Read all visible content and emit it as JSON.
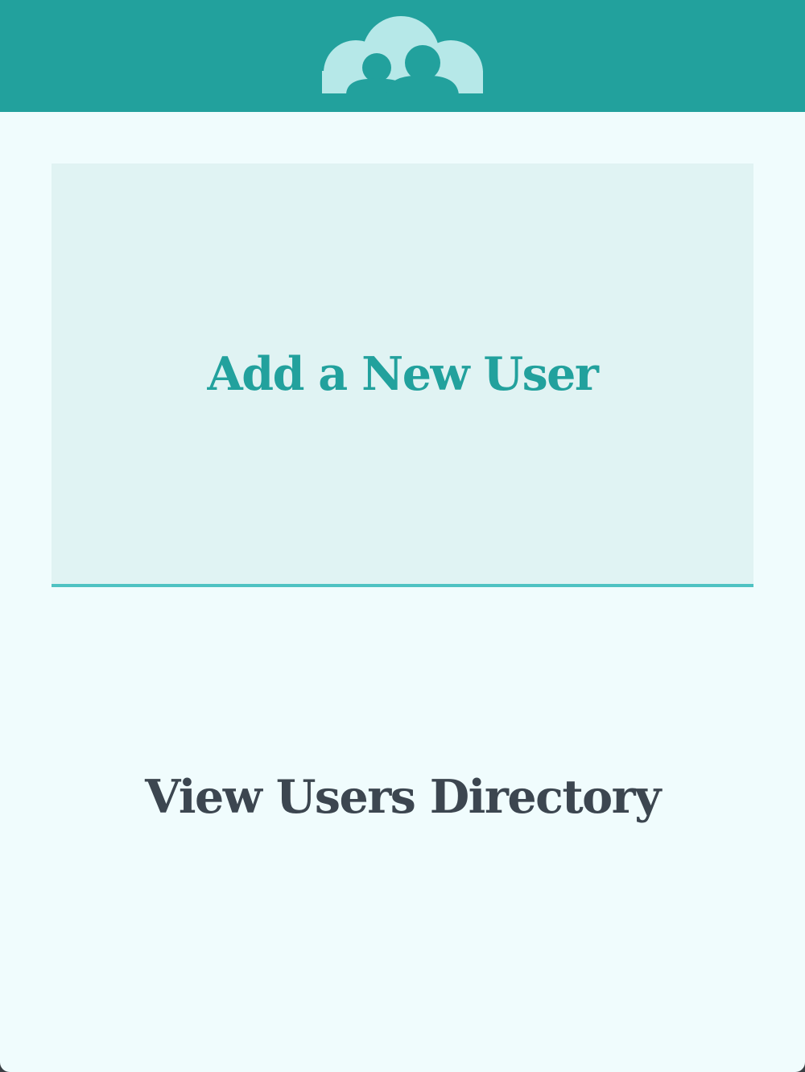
{
  "colors": {
    "header_bg": "#22a19d",
    "page_bg": "#f0fcfd",
    "active_item_bg": "#e0f3f3",
    "active_item_border": "#4fc2c2",
    "active_item_text": "#22a19d",
    "item_text": "#3c4650",
    "logo_fill": "#b6e8e8"
  },
  "header": {
    "logo_icon": "users-cloud-icon"
  },
  "menu": {
    "items": [
      {
        "label": "Add a New User",
        "state": "selected"
      },
      {
        "label": "View Users Directory",
        "state": "default"
      }
    ]
  }
}
